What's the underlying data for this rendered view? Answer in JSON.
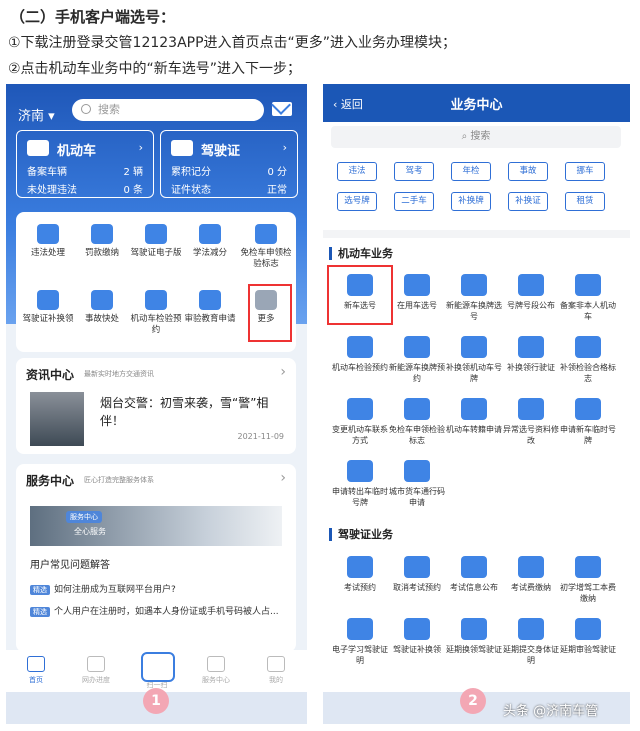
{
  "heading": "（二）手机客户端选号：",
  "step1": "①下载注册登录交管12123APP进入首页点击“更多”进入业务办理模块；",
  "step2": "②点击机动车业务中的“新车选号”进入下一步；",
  "p1": {
    "city": "济南",
    "search": "搜索",
    "card1": {
      "title": "机动车",
      "row1_label": "备案车辆",
      "row1_value": "2 辆",
      "row2_label": "未处理违法",
      "row2_value": "0 条"
    },
    "card2": {
      "title": "驾驶证",
      "row1_label": "累积记分",
      "row1_value": "0 分",
      "row2_label": "证件状态",
      "row2_value": "正常"
    },
    "services": [
      "违法处理",
      "罚款缴纳",
      "驾驶证电子版",
      "学法减分",
      "免检车申领检验标志",
      "驾驶证补换领",
      "事故快处",
      "机动车检验预约",
      "审验教育申请",
      "更多"
    ],
    "news": {
      "title": "资讯中心",
      "sub": "最新实时地方交通资讯",
      "headline": "烟台交警：初雪来袭，雪“警”相伴！",
      "date": "2021-11-09"
    },
    "svc": {
      "title": "服务中心",
      "sub": "匠心打造完整服务体系",
      "banner_tag": "服务中心",
      "banner_text": "全心服务",
      "faq_title": "用户常见问题解答",
      "tag": "精选",
      "faq1": "如何注册成为互联网平台用户?",
      "faq2": "个人用户在注册时，如遇本人身份证或手机号码被人占..."
    },
    "tabs": [
      "首页",
      "网办进度",
      "扫一扫",
      "服务中心",
      "我的"
    ],
    "badge": "1"
  },
  "p2": {
    "back": "返回",
    "title": "业务中心",
    "search": "搜索",
    "chips": [
      "违法",
      "驾考",
      "年检",
      "事故",
      "挪车",
      "选号牌",
      "二手车",
      "补换牌",
      "补换证",
      "租赁"
    ],
    "sec1": "机动车业务",
    "motor": [
      "新车选号",
      "在用车选号",
      "新能源车换牌选号",
      "号牌号段公布",
      "备案非本人机动车",
      "机动车检验预约",
      "新能源车换牌预约",
      "补换领机动车号牌",
      "补换领行驶证",
      "补领检验合格标志",
      "变更机动车联系方式",
      "免检车申领检验标志",
      "机动车转籍申请",
      "异常选号资料修改",
      "申请新车临时号牌",
      "申请转出车临时号牌",
      "城市货车通行码申请"
    ],
    "sec2": "驾驶证业务",
    "lic": [
      "考试预约",
      "取消考试预约",
      "考试信息公布",
      "考试费缴纳",
      "初学增驾工本费缴纳",
      "电子学习驾驶证明",
      "驾驶证补换领",
      "延期换领驾驶证",
      "延期提交身体证明",
      "延期审验驾驶证"
    ],
    "badge": "2",
    "watermark": "头条 @济南车管"
  }
}
